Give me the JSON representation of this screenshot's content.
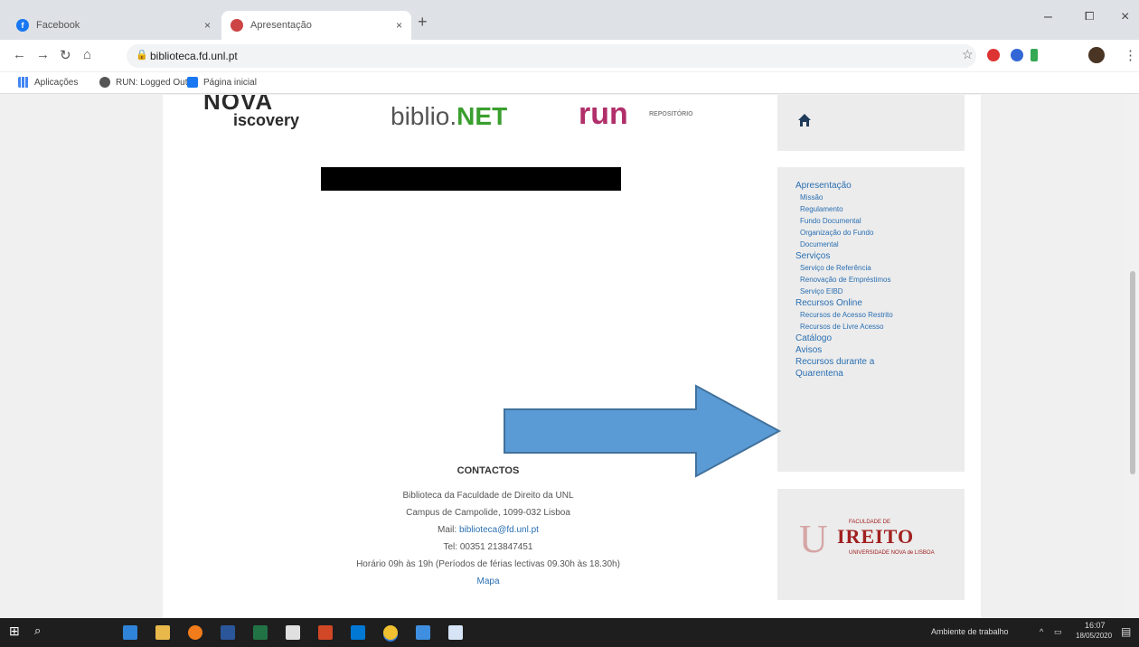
{
  "browser": {
    "tabs": [
      {
        "title": "Facebook",
        "close": "×"
      },
      {
        "title": "Apresentação",
        "close": "×"
      }
    ],
    "new_tab": "+",
    "window": {
      "minimize": "–",
      "maximize": "⧠",
      "close": "×"
    },
    "url": "biblioteca.fd.unl.pt",
    "bookmarks": [
      "Aplicações",
      "RUN: Logged Out",
      "Página inicial"
    ]
  },
  "page": {
    "logos": {
      "nova_top": "NOVA",
      "nova_bottom": "iscovery",
      "biblio_prefix": "biblio.",
      "biblio_suffix": "NET",
      "run": "run",
      "run_sub": "REPOSITÓRIO"
    },
    "contacts": {
      "heading": "CONTACTOS",
      "line1": "Biblioteca da Faculdade de Direito da UNL",
      "line2": "Campus de Campolide, 1099-032 Lisboa",
      "mail_label": "Mail: ",
      "mail_value": "biblioteca@fd.unl.pt",
      "tel": "Tel: 00351 213847451",
      "hours": "Horário 09h às 19h (Períodos de férias lectivas 09.30h às 18.30h)",
      "map_link": "Mapa"
    },
    "menu": [
      {
        "label": "Apresentação",
        "level": 0
      },
      {
        "label": "Missão",
        "level": 1
      },
      {
        "label": "Regulamento",
        "level": 1
      },
      {
        "label": "Fundo Documental",
        "level": 1
      },
      {
        "label": "Organização do Fundo",
        "level": 1
      },
      {
        "label": "Documental",
        "level": 1
      },
      {
        "label": "Serviços",
        "level": 0
      },
      {
        "label": "Serviço de Referência",
        "level": 1
      },
      {
        "label": "Renovação de Empréstimos",
        "level": 1
      },
      {
        "label": "Serviço EIBD",
        "level": 1
      },
      {
        "label": "Recursos Online",
        "level": 0
      },
      {
        "label": "Recursos de Acesso Restrito",
        "level": 1
      },
      {
        "label": "Recursos de Livre Acesso",
        "level": 1
      },
      {
        "label": "Catálogo",
        "level": 0
      },
      {
        "label": "Avisos",
        "level": 0
      },
      {
        "label": "Recursos durante a",
        "level": 0
      },
      {
        "label": "Quarentena",
        "level": 0
      }
    ],
    "faculty_logo": {
      "word": "IREITO",
      "tag_top": "FACULDADE DE",
      "tag_bottom": "UNIVERSIDADE NOVA de LISBOA"
    }
  },
  "taskbar": {
    "desktop_label": "Ambiente de trabalho",
    "time": "16:07",
    "date": "18/05/2020"
  },
  "colors": {
    "link": "#2a6fb2",
    "arrow": "#5b9bd5",
    "arrow_border": "#41719c"
  }
}
